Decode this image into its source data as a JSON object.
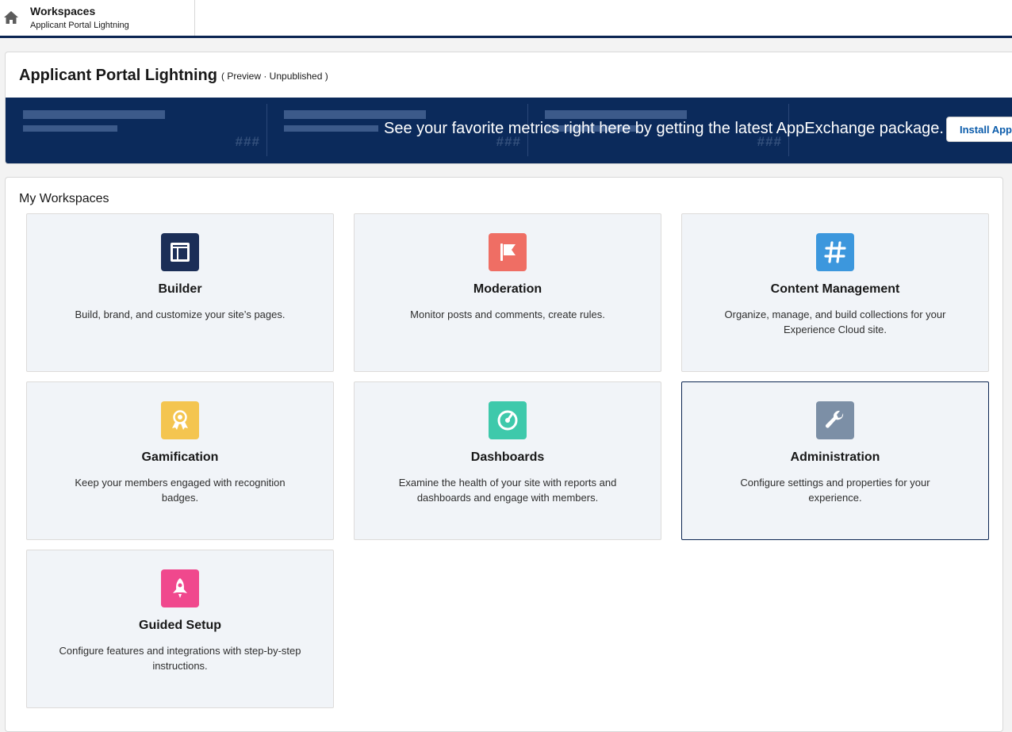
{
  "header": {
    "title": "Workspaces",
    "subtitle": "Applicant Portal Lightning"
  },
  "site": {
    "name": "Applicant Portal Lightning",
    "status": "( Preview · Unpublished )"
  },
  "banner": {
    "placeholder_value": "###",
    "message": "See your favorite metrics right here by getting the latest AppExchange package.",
    "install_label": "Install AppExchange Package"
  },
  "workspaces": {
    "heading": "My Workspaces",
    "tiles": [
      {
        "name": "Builder",
        "description": "Build, brand, and customize your site’s pages.",
        "icon": "builder-icon",
        "color": "#1b2e57"
      },
      {
        "name": "Moderation",
        "description": "Monitor posts and comments, create rules.",
        "icon": "flag-icon",
        "color": "#ef6e64"
      },
      {
        "name": "Content Management",
        "description": "Organize, manage, and build collections for your Experience Cloud site.",
        "icon": "hashtag-icon",
        "color": "#3c97dd"
      },
      {
        "name": "Gamification",
        "description": "Keep your members engaged with recognition badges.",
        "icon": "badge-icon",
        "color": "#f4c550"
      },
      {
        "name": "Dashboards",
        "description": "Examine the health of your site with reports and dashboards and engage with members.",
        "icon": "gauge-icon",
        "color": "#3ec9ab"
      },
      {
        "name": "Administration",
        "description": "Configure settings and properties for your experience.",
        "icon": "wrench-icon",
        "color": "#7c8fa6"
      },
      {
        "name": "Guided Setup",
        "description": "Configure features and integrations with step-by-step instructions.",
        "icon": "rocket-icon",
        "color": "#f0488d"
      }
    ]
  }
}
